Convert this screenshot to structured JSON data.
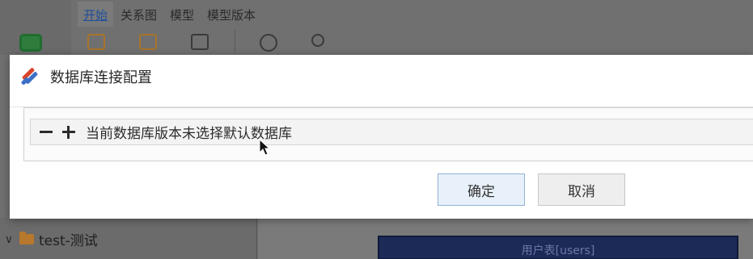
{
  "app": {
    "menu": [
      "开始",
      "关系图",
      "模型",
      "模型版本"
    ],
    "active_menu_index": 0,
    "tree_item_label": "test-测试",
    "entity_card_label": "用户表[users]"
  },
  "icons": {
    "app_logo": "dialog-logo-icon",
    "minus": "minus-icon",
    "plus": "plus-icon"
  },
  "colors": {
    "ok_button_bg": "#e8f1fa",
    "ok_button_border": "#8fb3d6",
    "logo_red": "#d9452b",
    "logo_blue": "#3d6fc7"
  },
  "dialog": {
    "title": "数据库连接配置",
    "status_text": "当前数据库版本未选择默认数据库",
    "ok_label": "确定",
    "cancel_label": "取消"
  }
}
